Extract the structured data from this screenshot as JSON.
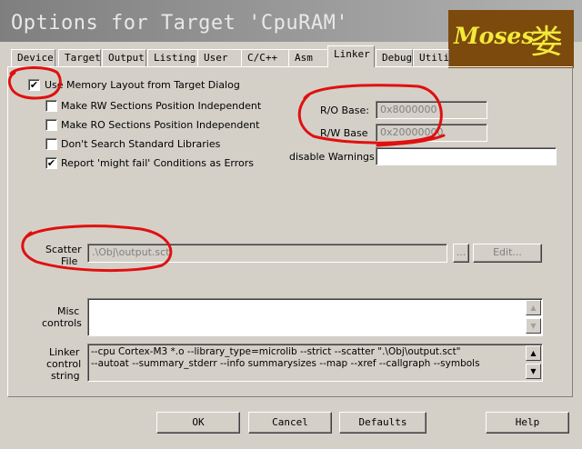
{
  "window": {
    "title": "Options for Target 'CpuRAM'"
  },
  "watermark": {
    "text": "Moses",
    "glyph": "娄"
  },
  "tabs": [
    "Device",
    "Target",
    "Output",
    "Listing",
    "User",
    "C/C++",
    "Asm",
    "Linker",
    "Debug",
    "Utilities"
  ],
  "active_tab": "Linker",
  "options": {
    "use_memory_layout": {
      "label": "Use Memory Layout from Target Dialog",
      "checked": true
    },
    "make_rw_pi": {
      "label": "Make RW Sections Position Independent",
      "checked": false
    },
    "make_ro_pi": {
      "label": "Make RO Sections Position Independent",
      "checked": false
    },
    "dont_search_libs": {
      "label": "Don't Search Standard Libraries",
      "checked": false
    },
    "report_might_fail": {
      "label": "Report 'might fail' Conditions as Errors",
      "checked": true
    }
  },
  "ro_base": {
    "label": "R/O Base:",
    "value": "0x8000000"
  },
  "rw_base": {
    "label": "R/W Base",
    "value": "0x20000000"
  },
  "disable_warnings": {
    "label": "disable Warnings:",
    "value": ""
  },
  "scatter": {
    "label_line1": "Scatter",
    "label_line2": "File",
    "value": ".\\Obj\\output.sct",
    "browse_label": "...",
    "edit_label": "Edit..."
  },
  "misc": {
    "label_line1": "Misc",
    "label_line2": "controls",
    "value": ""
  },
  "linker_control": {
    "label_line1": "Linker",
    "label_line2": "control",
    "label_line3": "string",
    "line1": "--cpu Cortex-M3 *.o --library_type=microlib --strict --scatter \".\\Obj\\output.sct\"",
    "line2": "--autoat --summary_stderr --info summarysizes --map --xref --callgraph --symbols"
  },
  "buttons": {
    "ok": "OK",
    "cancel": "Cancel",
    "defaults": "Defaults",
    "help": "Help"
  },
  "glyphs": {
    "check": "✔",
    "arrow_up": "▲",
    "arrow_down": "▼"
  },
  "colors": {
    "annotation": "#e01010",
    "watermark_bg": "#7b4a0c",
    "watermark_fg": "#f4e93a"
  }
}
